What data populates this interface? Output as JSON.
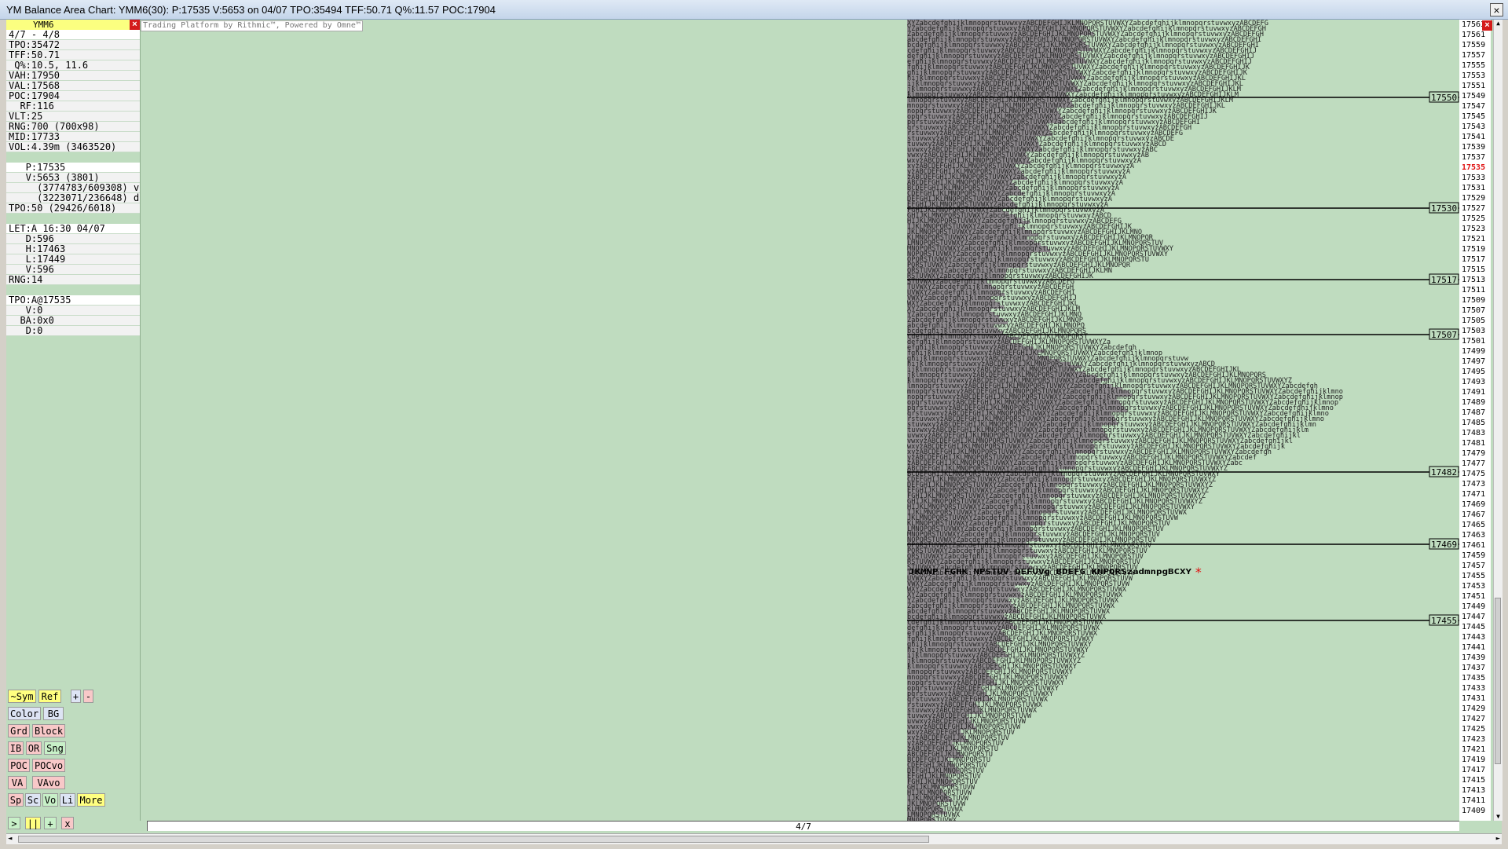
{
  "window": {
    "title": "YM Balance Area Chart: YMM6(30): P:17535 V:5653 on 04/07 TPO:35494 TFF:50.71 Q%:11.57 POC:17904",
    "close_icon": "×"
  },
  "panel": {
    "symbol": "YMM6",
    "close_icon": "×",
    "rows": [
      {
        "text": "4/7 - 4/8",
        "style": "w"
      },
      {
        "text": "TPO:35472",
        "style": "g"
      },
      {
        "text": "TFF:50.71",
        "style": "g"
      },
      {
        "text": " Q%:10.5, 11.6",
        "style": "g"
      },
      {
        "text": "VAH:17950",
        "style": "g"
      },
      {
        "text": "VAL:17568",
        "style": "g"
      },
      {
        "text": "POC:17904",
        "style": "g"
      },
      {
        "text": "  RF:116",
        "style": "g"
      },
      {
        "text": "VLT:25",
        "style": "g"
      },
      {
        "text": "RNG:700 (700x98)",
        "style": "g"
      },
      {
        "text": "MID:17733",
        "style": "g"
      },
      {
        "text": "VOL:4.39m (3463520)",
        "style": "g"
      },
      {
        "text": "",
        "style": "b"
      },
      {
        "text": "   P:17535",
        "style": "w"
      },
      {
        "text": "   V:5653 (3801)",
        "style": "g"
      },
      {
        "text": "     (3774783/609308) v",
        "style": "g"
      },
      {
        "text": "     (3223071/236648) d",
        "style": "g"
      },
      {
        "text": "TPO:50 (29426/6018)",
        "style": "g"
      },
      {
        "text": "",
        "style": "b"
      },
      {
        "text": "LET:A 16:30 04/07",
        "style": "w"
      },
      {
        "text": "   D:596",
        "style": "g"
      },
      {
        "text": "   H:17463",
        "style": "g"
      },
      {
        "text": "   L:17449",
        "style": "g"
      },
      {
        "text": "   V:596",
        "style": "g"
      },
      {
        "text": "RNG:14",
        "style": "g"
      },
      {
        "text": "",
        "style": "b"
      },
      {
        "text": "TPO:A@17535",
        "style": "w"
      },
      {
        "text": "   V:0",
        "style": "g"
      },
      {
        "text": "  BA:0x0",
        "style": "g"
      },
      {
        "text": "   D:0",
        "style": "g"
      }
    ]
  },
  "buttons": {
    "sym": "~Sym",
    "ref": "Ref",
    "plus": "+",
    "minus": "-",
    "color": "Color",
    "bg": "BG",
    "grd": "Grd",
    "block": "Block",
    "ib": "IB",
    "or": "OR",
    "sng": "Sng",
    "poc": "POC",
    "pocvo": "POCvo",
    "va": "VA",
    "vavo": "VAvo",
    "sp": "Sp",
    "sc": "Sc",
    "vo": "Vo",
    "li": "Li",
    "more": "More",
    "play": ">",
    "pause": "||",
    "add": "+",
    "remove": "x"
  },
  "watermark": "Trading Platform by Rithmic™, Powered by Omne™",
  "current_price": "17535",
  "price_axis_top": "17563",
  "price_axis_close_icon": "×",
  "levels": [
    "17550",
    "17530",
    "17517",
    "17507",
    "17482",
    "17469",
    "17455"
  ],
  "session_date": "4/7",
  "current_marker": "*",
  "profile_sample_text": "XYZabcdefghijklmnopqrstuvwxyzABCDEFGHIJKLMNOPQRSTUVW",
  "highlight_row_text": "JKMNP  FGHK NPSTUV  DEFUVg BDEFG  KNPQRSzadmnpgBCXY"
}
